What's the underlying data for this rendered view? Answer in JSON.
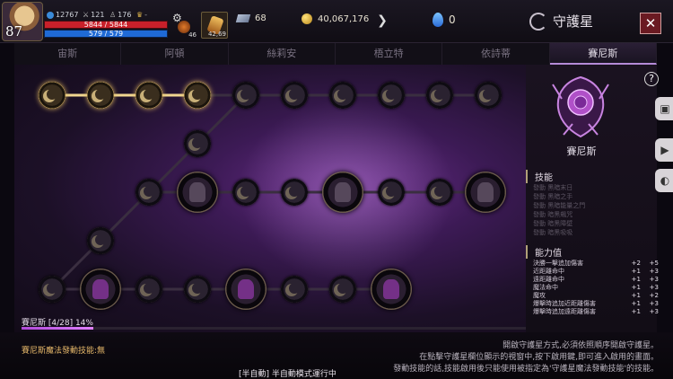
{
  "player": {
    "level": "87",
    "stat_a": "12767",
    "stat_b": "121",
    "stat_c": "176",
    "hp": "5844 / 5844",
    "mp": "579 / 579"
  },
  "items": {
    "potion1_count": "46",
    "potion2_count": "42,69"
  },
  "currency": {
    "gems": "68",
    "gold": "40,067,176",
    "crystals": "0"
  },
  "header": {
    "title": "守護星",
    "close_icon": "close-icon"
  },
  "tabs": [
    {
      "label": "宙斯"
    },
    {
      "label": "阿頓"
    },
    {
      "label": "絲莉安"
    },
    {
      "label": "梧立特"
    },
    {
      "label": "依詩蒂"
    },
    {
      "label": "賽尼斯"
    }
  ],
  "constellation": {
    "name": "賽尼斯",
    "progress_label": "賽尼斯 [4/28] 14%",
    "progress": 0.14
  },
  "skills": {
    "heading": "技能",
    "items": [
      "發動 黑暗末日",
      "發動 黑暗之手",
      "發動 黑暗能量之門",
      "發動 暗黑飆咒",
      "發動 暗黑障壁",
      "發動 暗黑吸吸"
    ]
  },
  "abilities": {
    "heading": "能力值",
    "rows": [
      {
        "name": "決勝一擊追加傷害",
        "v1": "+2",
        "v2": "+5"
      },
      {
        "name": "近距離命中",
        "v1": "+1",
        "v2": "+3"
      },
      {
        "name": "遠距離命中",
        "v1": "+1",
        "v2": "+3"
      },
      {
        "name": "魔法命中",
        "v1": "+1",
        "v2": "+3"
      },
      {
        "name": "魔攻",
        "v1": "+1",
        "v2": "+2"
      },
      {
        "name": "爆擊時追加近距離傷害",
        "v1": "+1",
        "v2": "+3"
      },
      {
        "name": "爆擊時追加遠距離傷害",
        "v1": "+1",
        "v2": "+3"
      }
    ]
  },
  "footer": {
    "magic_skill": "賽尼斯魔法發動技能:無",
    "note1": "開啟守護星方式,必須依照順序開啟守護星。",
    "note2": "在點擊守護星欄位顯示的視窗中,按下啟用鍵,即可進入啟用的畫面。",
    "note3": "發動技能的話,技能啟用後只能使用被指定為'守護星魔法發動技能'的技能。",
    "auto_mode": "[半自動] 半自動模式運行中"
  },
  "colors": {
    "accent": "#b58ad8",
    "progress": "#d070f0",
    "lit_node": "#d6b15e"
  }
}
